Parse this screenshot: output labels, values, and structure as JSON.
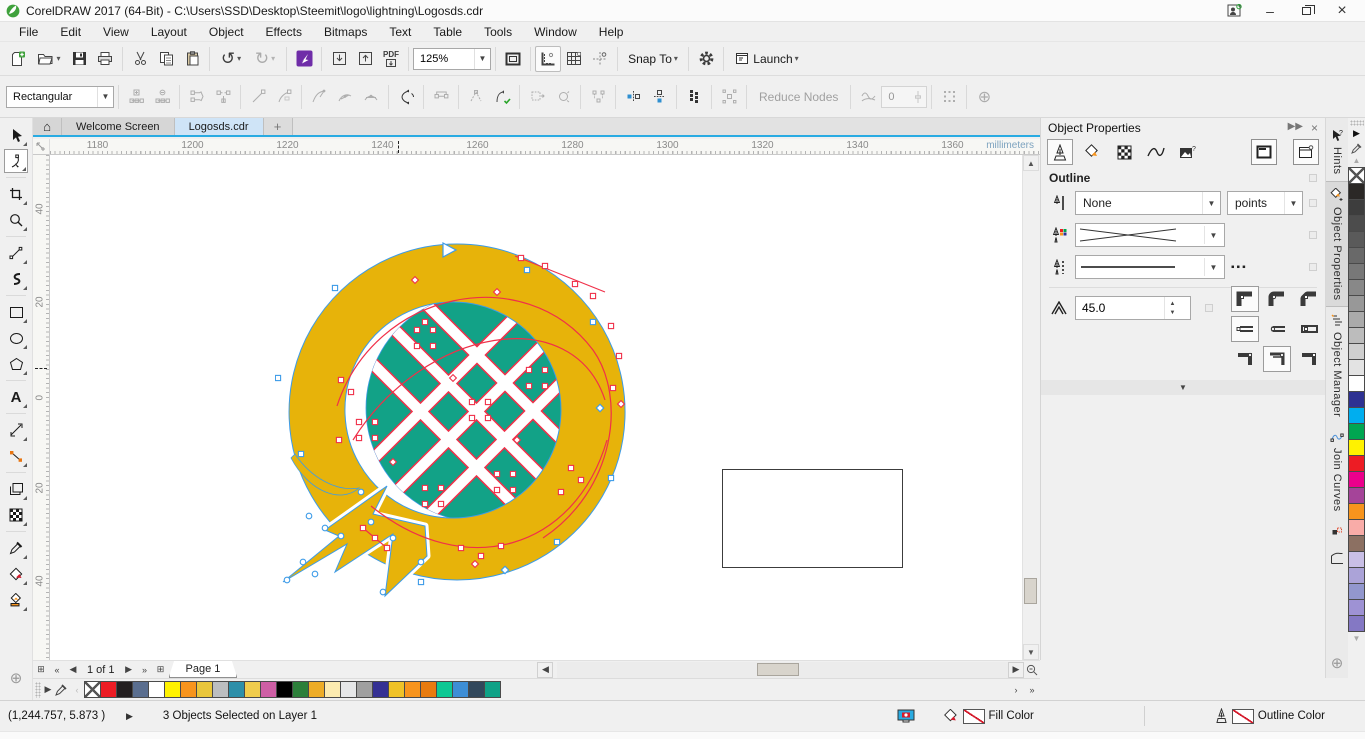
{
  "title_bar": {
    "title": "CorelDRAW 2017 (64-Bit) - C:\\Users\\SSD\\Desktop\\Steemit\\logo\\lightning\\Logosds.cdr"
  },
  "window_controls": {
    "minimize": "–",
    "close": "×"
  },
  "menu_bar": {
    "items": [
      "File",
      "Edit",
      "View",
      "Layout",
      "Object",
      "Effects",
      "Bitmaps",
      "Text",
      "Table",
      "Tools",
      "Window",
      "Help"
    ]
  },
  "standard_toolbar": {
    "zoom_level": "125%",
    "pdf_label": "PDF",
    "snap_to_label": "Snap To",
    "launch_label": "Launch",
    "icons": [
      "new-document",
      "open",
      "save",
      "print",
      "cut",
      "copy",
      "paste",
      "undo",
      "redo",
      "search-content",
      "import",
      "export",
      "publish-to-pdf",
      "zoom-levels",
      "full-screen-preview",
      "show-rulers",
      "show-grid",
      "show-guidelines",
      "snap-to",
      "options",
      "launch"
    ]
  },
  "property_bar": {
    "selection_mode": "Rectangular",
    "reduce_nodes_label": "Reduce Nodes",
    "curve_smoothness": "0",
    "icons": [
      "add-nodes",
      "delete-nodes",
      "join-nodes",
      "break-curve",
      "convert-to-line",
      "convert-to-curve",
      "cusp-node",
      "smooth-node",
      "symmetrical-node",
      "reverse-direction",
      "extend-curve-to-close",
      "extract-subpath",
      "close-curve",
      "stretch-nodes",
      "rotate-skew-nodes",
      "align-nodes",
      "reflect-nodes-horizontally",
      "reflect-nodes-vertically",
      "elastic-mode",
      "select-all-nodes",
      "curve-smoothness-slider",
      "box-selection-mode"
    ]
  },
  "document_tabs": {
    "welcome_tab": "Welcome Screen",
    "document_tab": "Logosds.cdr"
  },
  "rulers": {
    "horizontal_labels": [
      "1180",
      "1200",
      "1220",
      "1240",
      "1260",
      "1280",
      "1300",
      "1320",
      "1340",
      "1360"
    ],
    "unit_label": "millimeters",
    "vertical_labels": [
      "40",
      "20",
      "0",
      "20",
      "40"
    ]
  },
  "toolbox": {
    "tools": [
      "pick",
      "shape",
      "crop",
      "zoom",
      "freehand",
      "artistic-media",
      "rectangle",
      "ellipse",
      "polygon",
      "text",
      "parallel-dimension",
      "connector",
      "drop-shadow",
      "transparency",
      "color-eyedropper",
      "interactive-fill",
      "smart-fill"
    ],
    "active_tool": "shape",
    "text_tool_glyph": "A"
  },
  "object_properties": {
    "panel_title": "Object Properties",
    "section_title": "Outline",
    "outline_width_value": "None",
    "outline_width_unit": "points",
    "miter_limit": "45.0",
    "tab_icons": [
      "outline",
      "fill",
      "transparency",
      "curve",
      "bitmap",
      "summary",
      "style-indicator"
    ]
  },
  "dockers": {
    "tabs": [
      "Hints",
      "Object Properties",
      "Object Manager",
      "Join Curves"
    ],
    "active": "Object Properties"
  },
  "color_palette": {
    "colors": [
      "#2B2826",
      "#3D3D3D",
      "#4C4C4C",
      "#5A5A5A",
      "#696969",
      "#787878",
      "#888888",
      "#989898",
      "#AAAAAA",
      "#BCBCBC",
      "#CFCFCF",
      "#E3E3E3",
      "#FFFFFF",
      "#2E3192",
      "#00AEEF",
      "#00A651",
      "#FFF200",
      "#ED1C24",
      "#EC008C",
      "#A54499",
      "#F7941D",
      "#F9ACA8",
      "#8C7062",
      "#C9BFE6",
      "#ABA3D8",
      "#9297CE",
      "#9E92D4",
      "#8478C4"
    ]
  },
  "document_palette": {
    "colors": [
      "#ED1C24",
      "#231F20",
      "#5A6E8F",
      "#FFFFFF",
      "#FFF200",
      "#F7941D",
      "#E9C63B",
      "#BCBEC0",
      "#2D8FA9",
      "#F0CC4D",
      "#CE5FA5",
      "#000000",
      "#2C7F3A",
      "#EDAC27",
      "#FCEBB0",
      "#E6E7E8",
      "#A0A0A0",
      "#343093",
      "#EFC227",
      "#F7941D",
      "#E87B0F",
      "#0DC894",
      "#3D8ED6",
      "#32485C",
      "#0FA287"
    ]
  },
  "page_navigation": {
    "position_label": "1 of 1",
    "page_tab": "Page 1"
  },
  "status_bar": {
    "cursor_position": "(1,244.757, 5.873 )",
    "selection_info": "3 Objects Selected on Layer 1",
    "fill_label": "Fill Color",
    "outline_label": "Outline Color"
  },
  "artwork": {
    "logo_yellow": "#E7B30A",
    "logo_teal": "#12A287",
    "selection_blue": "#3C9BE8",
    "node_red": "#F03049"
  }
}
